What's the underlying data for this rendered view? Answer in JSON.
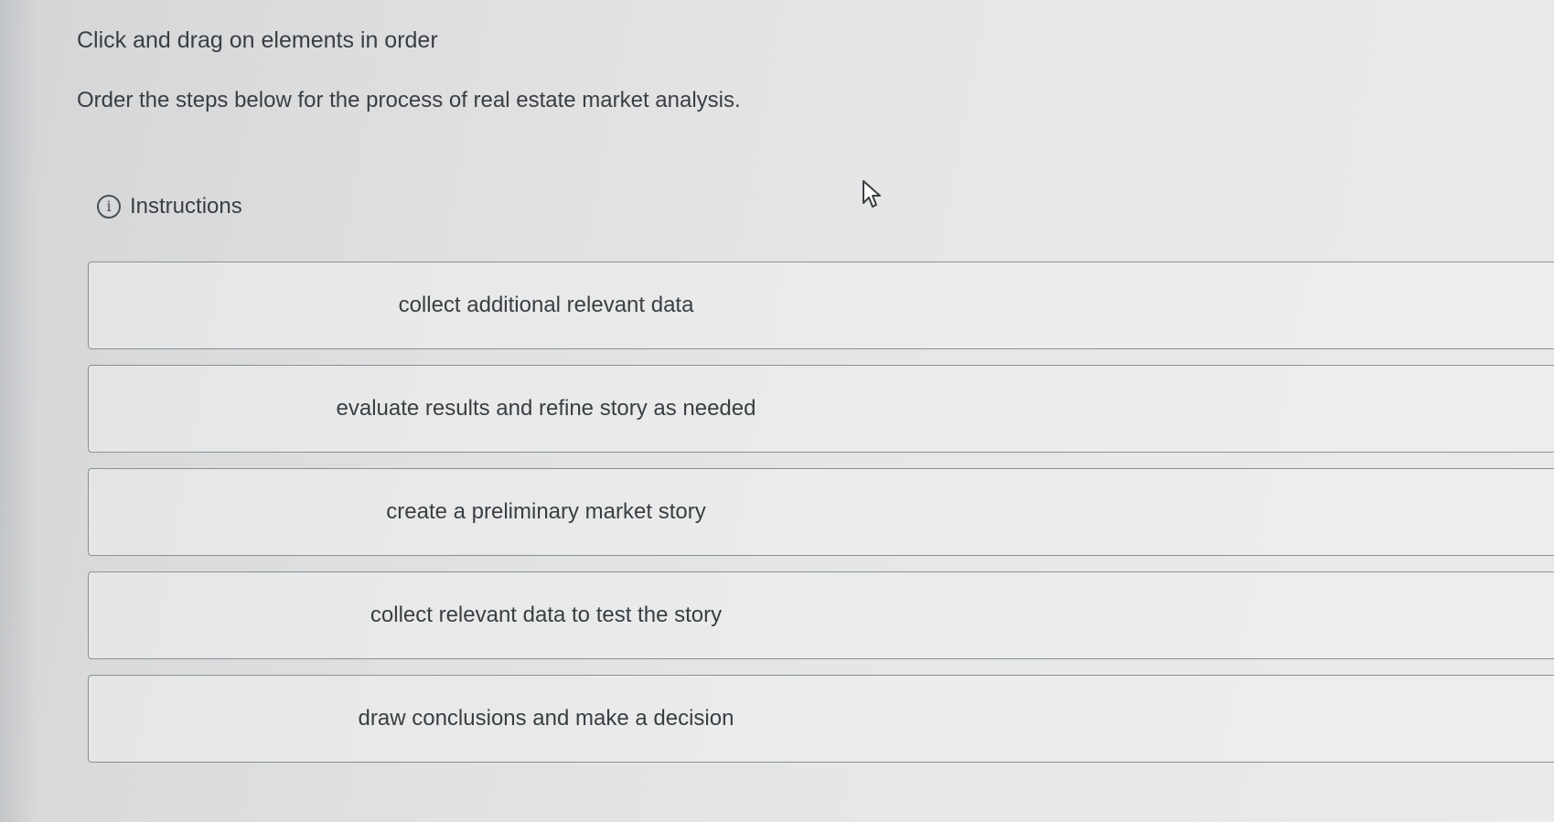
{
  "header": {
    "prompt": "Click and drag on elements in order",
    "question": "Order the steps below for the process of real estate market analysis."
  },
  "instructions": {
    "icon": "info-icon",
    "label": "Instructions"
  },
  "steps": [
    {
      "label": "collect additional relevant data"
    },
    {
      "label": "evaluate results and refine story as needed"
    },
    {
      "label": "create a preliminary market story"
    },
    {
      "label": "collect relevant data to test the story"
    },
    {
      "label": "draw conclusions and make a decision"
    }
  ]
}
